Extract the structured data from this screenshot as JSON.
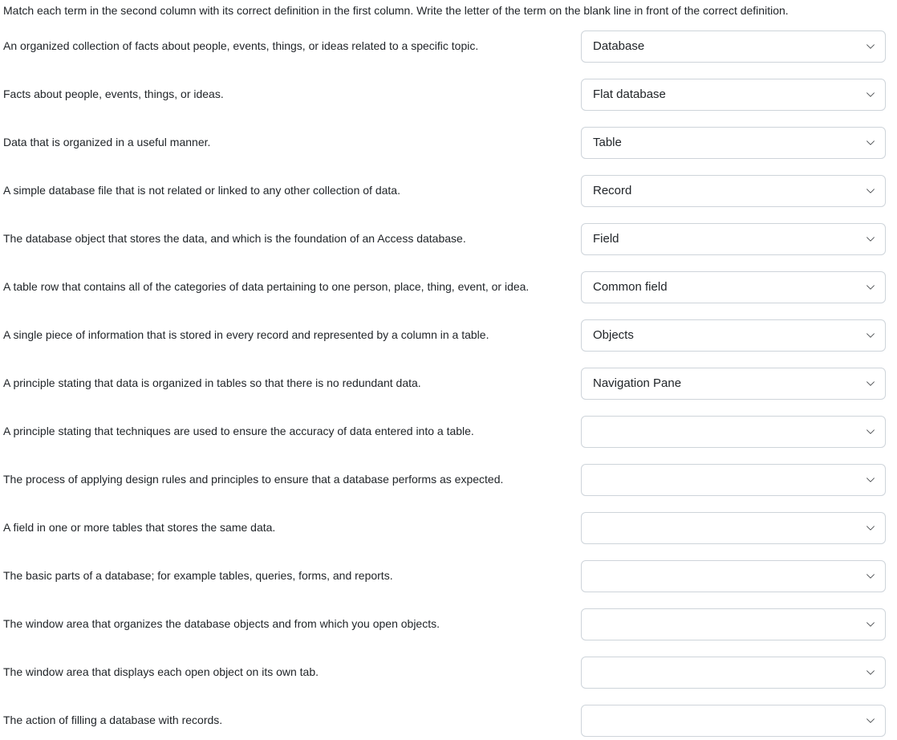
{
  "instructions": "Match each term in the second column with its correct definition in the first column. Write the letter of the term on the blank line in front of the correct definition.",
  "rows": [
    {
      "definition": "An organized collection of facts about people, events, things, or ideas related to a specific topic.",
      "selected": "Database"
    },
    {
      "definition": "Facts about people, events, things, or ideas.",
      "selected": "Flat database"
    },
    {
      "definition": "Data that is organized in a useful manner.",
      "selected": "Table"
    },
    {
      "definition": "A simple database file that is not related or linked to any other collection of data.",
      "selected": "Record"
    },
    {
      "definition": "The database object that stores the data, and which is the foundation of an Access database.",
      "selected": "Field"
    },
    {
      "definition": "A table row that contains all of the categories of data pertaining to one person, place, thing, event, or idea.",
      "selected": "Common field"
    },
    {
      "definition": "A single piece of information that is stored in every record and represented by a column in a table.",
      "selected": "Objects"
    },
    {
      "definition": "A principle stating that data is organized in tables so that there is no redundant data.",
      "selected": "Navigation Pane"
    },
    {
      "definition": "A principle stating that techniques are used to ensure the accuracy of data entered into a table.",
      "selected": ""
    },
    {
      "definition": "The process of applying design rules and principles to ensure that a database performs as expected.",
      "selected": ""
    },
    {
      "definition": "A field in one or more tables that stores the same data.",
      "selected": ""
    },
    {
      "definition": "The basic parts of a database; for example tables, queries, forms, and reports.",
      "selected": ""
    },
    {
      "definition": "The window area that organizes the database objects and from which you open objects.",
      "selected": ""
    },
    {
      "definition": "The window area that displays each open object on its own tab.",
      "selected": ""
    },
    {
      "definition": "The action of filling a database with records.",
      "selected": ""
    }
  ]
}
